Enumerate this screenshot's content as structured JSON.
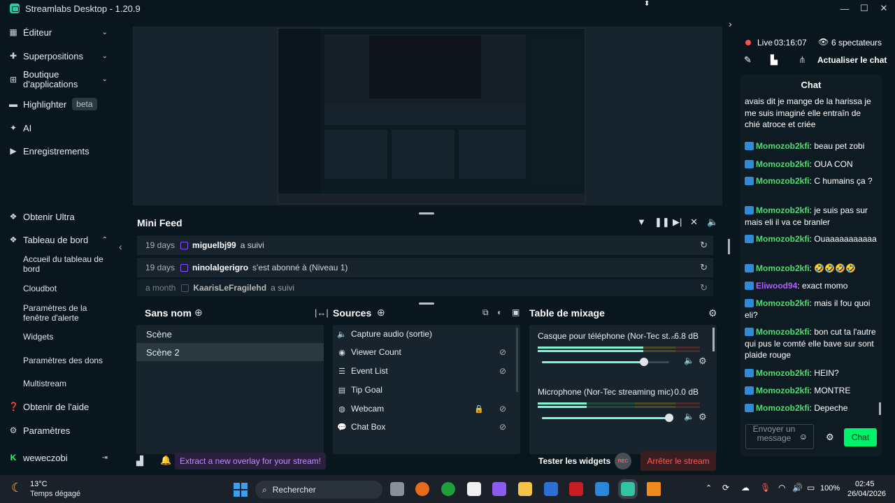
{
  "app": {
    "title": "Streamlabs Desktop - 1.20.9"
  },
  "sidebar": {
    "items": [
      {
        "label": "Éditeur"
      },
      {
        "label": "Superpositions"
      },
      {
        "label": "Boutique d'applications"
      },
      {
        "label": "Highlighter",
        "badge": "beta"
      },
      {
        "label": "AI"
      },
      {
        "label": "Enregistrements"
      },
      {
        "label": "Obtenir Ultra"
      },
      {
        "label": "Tableau de bord"
      }
    ],
    "subitems": [
      "Accueil du tableau de bord",
      "Cloudbot",
      "Paramètres de la fenêtre d'alerte",
      "Widgets",
      "Paramètres des dons",
      "Multistream"
    ],
    "bottom": [
      {
        "label": "Obtenir de l'aide"
      },
      {
        "label": "Paramètres"
      },
      {
        "label": "weweczobi"
      }
    ]
  },
  "minifeed": {
    "title": "Mini Feed",
    "rows": [
      {
        "time": "19 days",
        "name": "miguelbj99",
        "action": "a suivi"
      },
      {
        "time": "19 days",
        "name": "ninolalgerigro",
        "action": "s'est abonné à (Niveau 1)"
      },
      {
        "time": "a month",
        "name": "KaarisLeFragilehd",
        "action": "a suivi"
      }
    ]
  },
  "scenes": {
    "title": "Sans nom",
    "items": [
      "Scène",
      "Scène 2"
    ]
  },
  "sources": {
    "title": "Sources",
    "items": [
      "Capture audio (sortie)",
      "Viewer Count",
      "Event List",
      "Tip Goal",
      "Webcam",
      "Chat Box"
    ]
  },
  "mixer": {
    "title": "Table de mixage",
    "channels": [
      {
        "name": "Casque pour téléphone (Nor-Tec st...",
        "db": "-6.8 dB",
        "level": 0.65,
        "volume": 0.8
      },
      {
        "name": "Microphone (Nor-Tec streaming mic)",
        "db": "0.0 dB",
        "level": 0.3,
        "volume": 1.0
      }
    ]
  },
  "bottombar": {
    "promo": "Extract a new overlay for your stream!",
    "test_widgets": "Tester les widgets",
    "rec": "REC",
    "stop": "Arrêter le stream"
  },
  "live": {
    "status": "Live",
    "time": "03:16:07",
    "viewers": "6 spectateurs",
    "refresh_chat": "Actualiser le chat"
  },
  "chat": {
    "title": "Chat",
    "messages": [
      {
        "user": "",
        "text": "avais dit je mange de la harissa je me suis imaginé elle entraîn de chié atroce et criée"
      },
      {
        "user": "Momozob2kfi",
        "text": ": beau pet zobi"
      },
      {
        "user": "Momozob2kfi",
        "text": ": OUA CON"
      },
      {
        "user": "Momozob2kfi",
        "text": ": C humains ça ?"
      },
      {
        "user": "Momozob2kfi",
        "text": ": je suis pas sur mais eli il va ce branler"
      },
      {
        "user": "Momozob2kfi",
        "text": ": Ouaaaaaaaaaaa"
      },
      {
        "user": "Momozob2kfi",
        "text": ": 🤣🤣🤣🤣"
      },
      {
        "user": "Eliwood94",
        "text": ": exact momo"
      },
      {
        "user": "Momozob2kfi",
        "text": ": mais il fou quoi eli?"
      },
      {
        "user": "Momozob2kfi",
        "text": ": bon cut ta l'autre qui pus le comté elle bave sur sont plaide rouge"
      },
      {
        "user": "Momozob2kfi",
        "text": ": HEIN?"
      },
      {
        "user": "Momozob2kfi",
        "text": ": MONTRE"
      },
      {
        "user": "Momozob2kfi",
        "text": ": Depeche"
      }
    ],
    "input_placeholder": "Envoyer un message",
    "send": "Chat"
  },
  "taskbar": {
    "weather_temp": "13°C",
    "weather_desc": "Temps dégagé",
    "search": "Rechercher",
    "battery": "100%",
    "time": "02:45",
    "date": "26/04/2026"
  },
  "colors": {
    "accent": "#31c3a2",
    "live_red": "#ff4f4f",
    "chat_green": "#4ddf6f",
    "send_green": "#00f26a"
  }
}
